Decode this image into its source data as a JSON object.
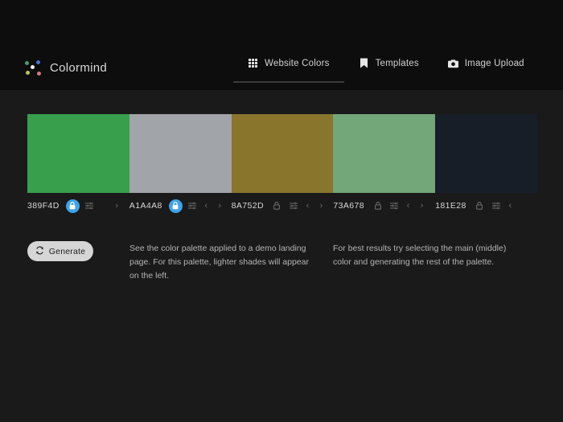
{
  "app": {
    "brand_name": "Colormind",
    "logo_icon": "colormind-dots-logo",
    "background_color": "#1a1a1a",
    "header_color": "#0d0d0d"
  },
  "nav": {
    "items": [
      {
        "label": "Website Colors",
        "icon": "grid-icon",
        "active": true
      },
      {
        "label": "Templates",
        "icon": "bookmark-icon",
        "active": false
      },
      {
        "label": "Image Upload",
        "icon": "camera-icon",
        "active": false
      }
    ]
  },
  "palette": {
    "swatches": [
      {
        "hex": "389F4D",
        "color": "#389F4D",
        "locked": true,
        "lock_icon": "lock-icon",
        "sliders_icon": "sliders-icon",
        "prev_icon": "",
        "next_icon": "›"
      },
      {
        "hex": "A1A4A8",
        "color": "#A1A4A8",
        "locked": true,
        "lock_icon": "lock-icon",
        "sliders_icon": "sliders-icon",
        "prev_icon": "‹",
        "next_icon": "›"
      },
      {
        "hex": "8A752D",
        "color": "#8A752D",
        "locked": false,
        "lock_icon": "lock-icon",
        "sliders_icon": "sliders-icon",
        "prev_icon": "‹",
        "next_icon": "›"
      },
      {
        "hex": "73A678",
        "color": "#73A678",
        "locked": false,
        "lock_icon": "lock-icon",
        "sliders_icon": "sliders-icon",
        "prev_icon": "‹",
        "next_icon": "›"
      },
      {
        "hex": "181E28",
        "color": "#181E28",
        "locked": false,
        "lock_icon": "lock-icon",
        "sliders_icon": "sliders-icon",
        "prev_icon": "‹",
        "next_icon": ""
      }
    ],
    "lock_active_color": "#3ea3e8"
  },
  "actions": {
    "generate_label": "Generate",
    "generate_icon": "refresh-icon"
  },
  "info": {
    "left_text": "See the color palette applied to a demo landing page. For this palette, lighter shades will appear on the left.",
    "right_text": "For best results try selecting the main (middle) color and generating the rest of the palette."
  }
}
